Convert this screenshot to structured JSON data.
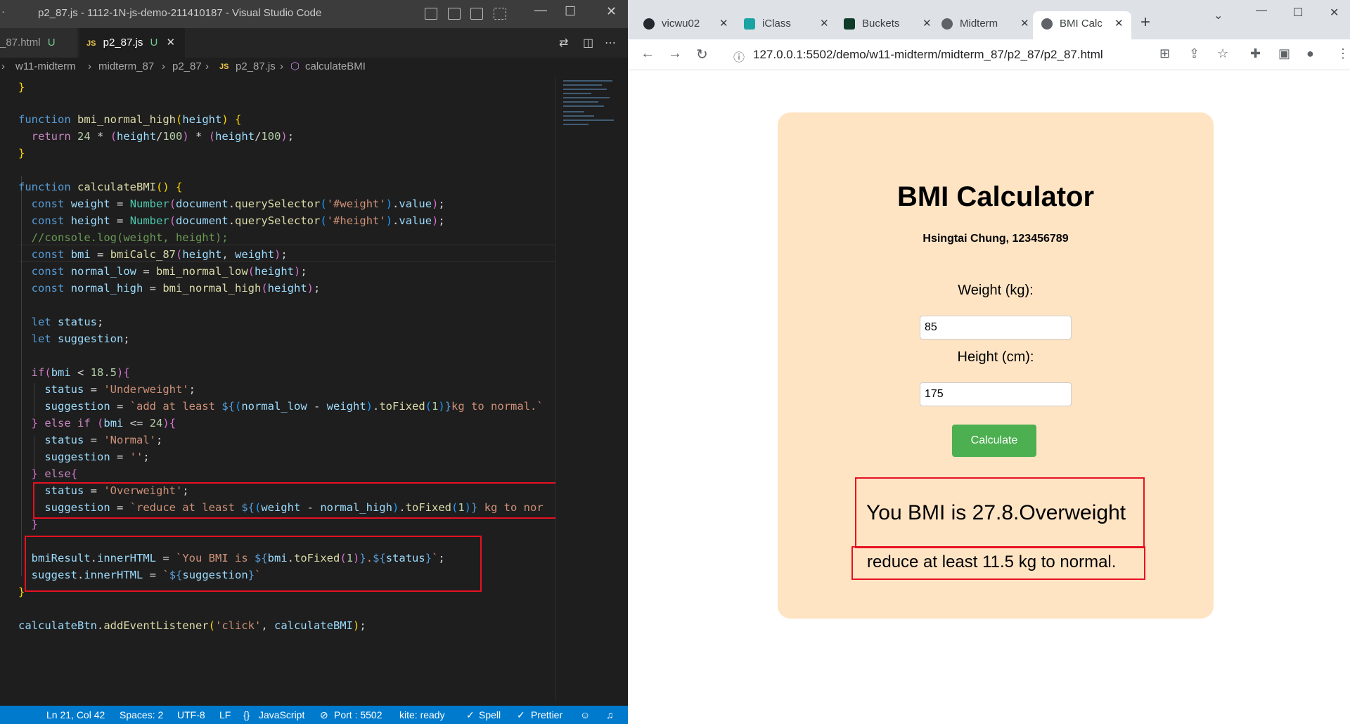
{
  "vscode": {
    "window_title": "p2_87.js - 1112-1N-js-demo-211410187 - Visual Studio Code",
    "tabs": [
      {
        "label": "_87.html",
        "status": "U"
      },
      {
        "label": "p2_87.js",
        "status": "U",
        "badge": "JS"
      }
    ],
    "breadcrumb": [
      "w11-midterm",
      "midterm_87",
      "p2_87",
      "p2_87.js",
      "calculateBMI"
    ],
    "status_bar": {
      "position": "Ln 21, Col 42",
      "spaces": "Spaces: 2",
      "encoding": "UTF-8",
      "eol": "LF",
      "language": "JavaScript",
      "port": "Port : 5502",
      "kite": "kite: ready",
      "spell": "Spell",
      "prettier": "Prettier"
    }
  },
  "browser": {
    "tabs": [
      {
        "label": "vicwu02",
        "icon": "github-icon"
      },
      {
        "label": "iClass",
        "icon": "iclass-icon"
      },
      {
        "label": "Buckets",
        "icon": "buckets-icon"
      },
      {
        "label": "Midterm",
        "icon": "globe-icon"
      },
      {
        "label": "BMI Calc",
        "icon": "globe-icon",
        "active": true
      }
    ],
    "url": "127.0.0.1:5502/demo/w11-midterm/midterm_87/p2_87/p2_87.html"
  },
  "bmi_page": {
    "title": "BMI Calculator",
    "author": "Hsingtai Chung, 123456789",
    "weight_label": "Weight (kg):",
    "weight_value": "85",
    "height_label": "Height (cm):",
    "height_value": "175",
    "button_label": "Calculate",
    "result_text": "You BMI is 27.8.Overweight",
    "suggestion_text": "reduce at least 11.5 kg to normal."
  },
  "colors": {
    "card_bg": "#ffe4c4",
    "button_bg": "#4caf50",
    "highlight_box": "#e81123",
    "statusbar": "#007acc"
  }
}
